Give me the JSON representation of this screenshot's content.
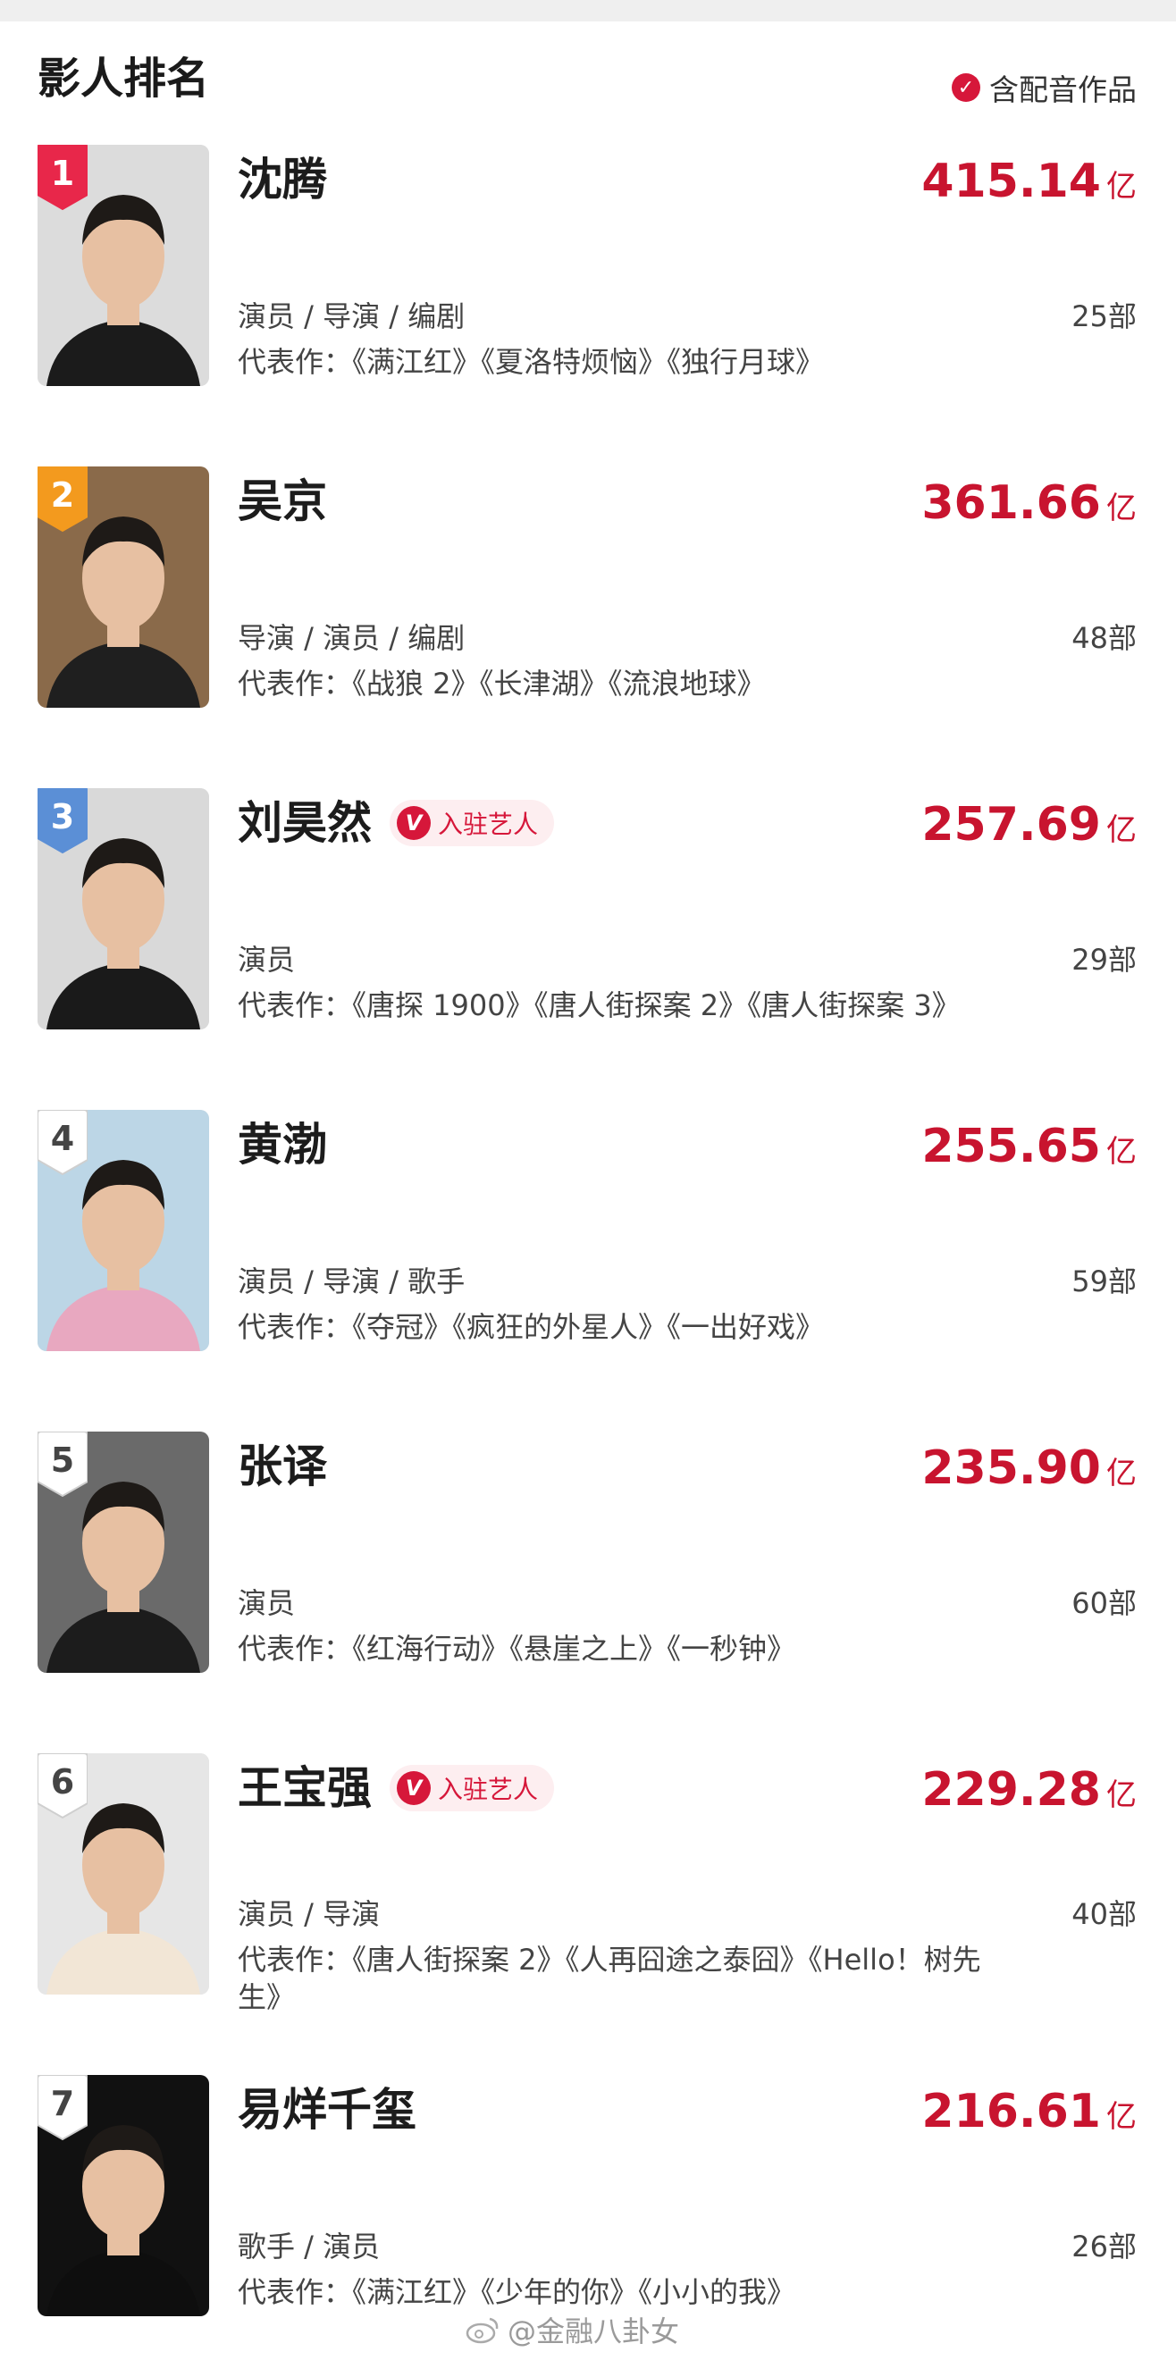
{
  "page": {
    "title": "影人排名",
    "filter_label": "含配音作品",
    "accent_color": "#d6173a"
  },
  "badge_label": "入驻艺人",
  "units": {
    "amount": "亿",
    "count_suffix": "部"
  },
  "people": [
    {
      "rank": "1",
      "name": "沈腾",
      "verified": false,
      "box_office": "415.14",
      "roles": "演员 / 导演 / 编剧",
      "count": "25部",
      "works": "代表作：《满江红》《夏洛特烦恼》《独行月球》",
      "rank_color": "#e8274a"
    },
    {
      "rank": "2",
      "name": "吴京",
      "verified": false,
      "box_office": "361.66",
      "roles": "导演 / 演员 / 编剧",
      "count": "48部",
      "works": "代表作：《战狼 2》《长津湖》《流浪地球》",
      "rank_color": "#f39a1e"
    },
    {
      "rank": "3",
      "name": "刘昊然",
      "verified": true,
      "box_office": "257.69",
      "roles": "演员",
      "count": "29部",
      "works": "代表作：《唐探 1900》《唐人街探案 2》《唐人街探案 3》",
      "rank_color": "#5b8fd6"
    },
    {
      "rank": "4",
      "name": "黄渤",
      "verified": false,
      "box_office": "255.65",
      "roles": "演员 / 导演 / 歌手",
      "count": "59部",
      "works": "代表作：《夺冠》《疯狂的外星人》《一出好戏》",
      "rank_color": "#ffffff"
    },
    {
      "rank": "5",
      "name": "张译",
      "verified": false,
      "box_office": "235.90",
      "roles": "演员",
      "count": "60部",
      "works": "代表作：《红海行动》《悬崖之上》《一秒钟》",
      "rank_color": "#ffffff"
    },
    {
      "rank": "6",
      "name": "王宝强",
      "verified": true,
      "box_office": "229.28",
      "roles": "演员 / 导演",
      "count": "40部",
      "works": "代表作：《唐人街探案 2》《人再囧途之泰囧》《Hello！树先生》",
      "rank_color": "#ffffff"
    },
    {
      "rank": "7",
      "name": "易烊千玺",
      "verified": false,
      "box_office": "216.61",
      "roles": "歌手 / 演员",
      "count": "26部",
      "works": "代表作：《满江红》《少年的你》《小小的我》",
      "rank_color": "#ffffff"
    }
  ],
  "watermark": "@金融八卦女"
}
